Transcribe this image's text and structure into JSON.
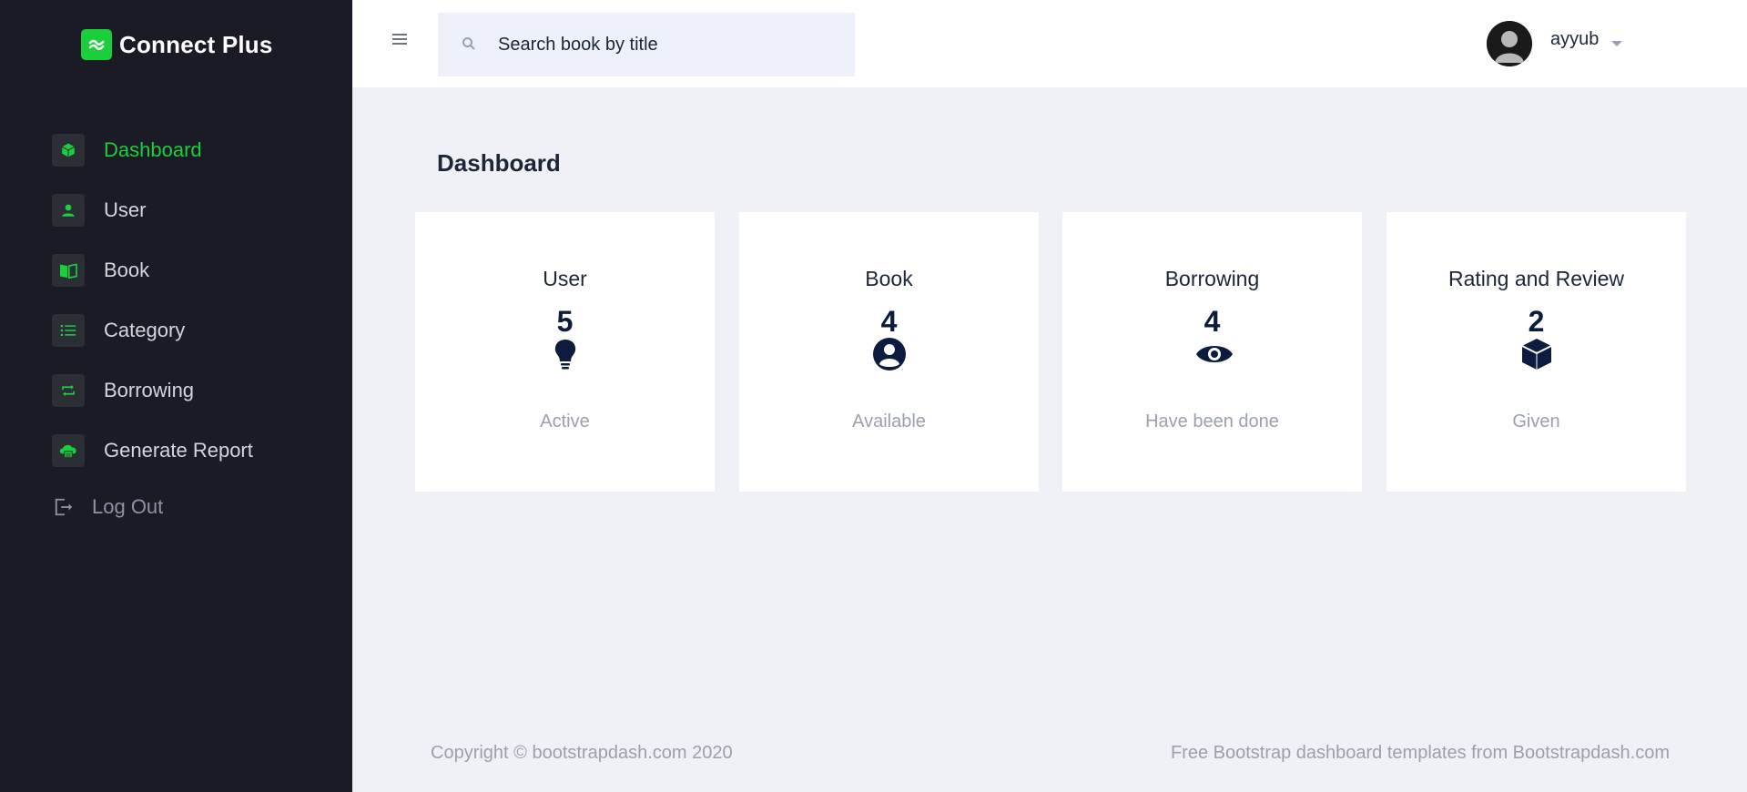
{
  "brand": {
    "name": "Connect Plus"
  },
  "sidebar": {
    "items": [
      {
        "label": "Dashboard",
        "icon": "cube-icon",
        "active": true
      },
      {
        "label": "User",
        "icon": "user-icon"
      },
      {
        "label": "Book",
        "icon": "book-icon"
      },
      {
        "label": "Category",
        "icon": "list-icon"
      },
      {
        "label": "Borrowing",
        "icon": "repeat-icon"
      },
      {
        "label": "Generate Report",
        "icon": "cloud-print-icon"
      }
    ],
    "logout": {
      "label": "Log Out",
      "icon": "logout-icon"
    }
  },
  "topbar": {
    "search": {
      "placeholder": "Search book by title"
    },
    "user": {
      "name": "ayyub"
    }
  },
  "main": {
    "title": "Dashboard",
    "cards": [
      {
        "title": "User",
        "value": "5",
        "icon": "lightbulb-icon",
        "subtitle": "Active"
      },
      {
        "title": "Book",
        "value": "4",
        "icon": "account-circle-icon",
        "subtitle": "Available"
      },
      {
        "title": "Borrowing",
        "value": "4",
        "icon": "eye-icon",
        "subtitle": "Have been done"
      },
      {
        "title": "Rating and Review",
        "value": "2",
        "icon": "cube-icon",
        "subtitle": "Given"
      }
    ]
  },
  "footer": {
    "copyright": "Copyright © bootstrapdash.com 2020",
    "credit": "Free Bootstrap dashboard templates from Bootstrapdash.com"
  },
  "colors": {
    "accent": "#1bcf3a",
    "sidebar_bg": "#1b1b26",
    "page_bg": "#f0f1f6",
    "icon_dark": "#0d1b3e"
  }
}
